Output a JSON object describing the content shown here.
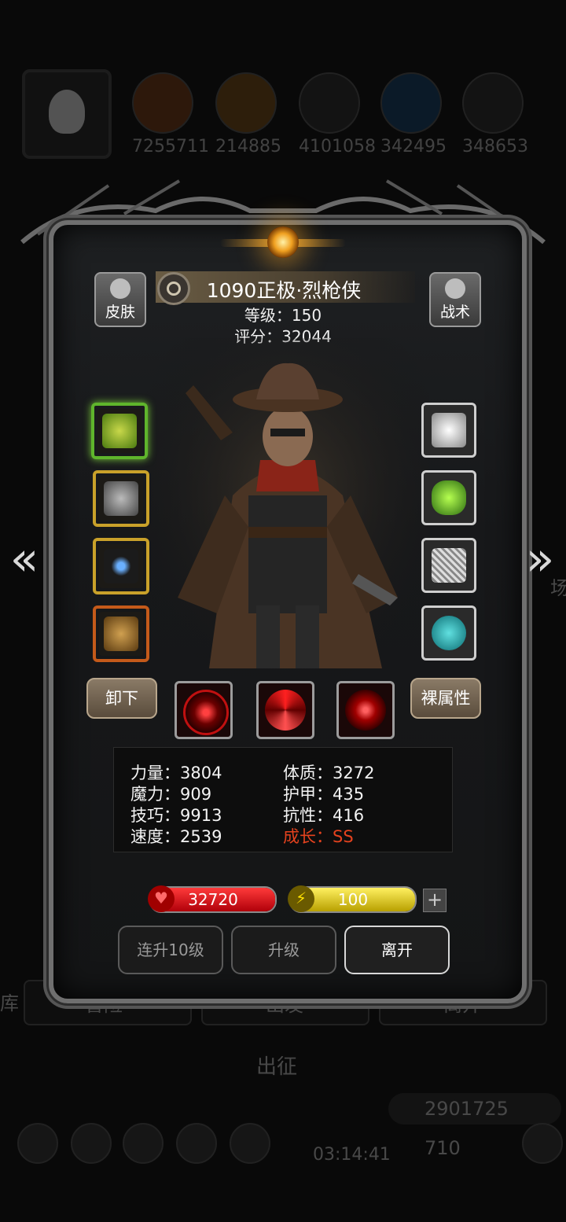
{
  "background": {
    "resources": [
      "7255711",
      "214885",
      "4101058",
      "342495",
      "348653"
    ],
    "bottom_buttons": [
      "冒险",
      "出发",
      "离开"
    ],
    "march_label": "出征",
    "gold": "2901725",
    "gems": "710",
    "timer": "03:14:41",
    "left_edge_text": "库",
    "right_edge_text": "场"
  },
  "hero": {
    "name": "1090正极·烈枪侠",
    "level": "等级：150",
    "score": "评分：32044"
  },
  "corner_buttons": {
    "skin": "皮肤",
    "tactics": "战术"
  },
  "equipment": {
    "left": [
      "golden-gun",
      "silver-armor",
      "blue-amulet",
      "bronze-horn"
    ],
    "right": [
      "cloud-ring",
      "green-gem",
      "chainmail",
      "cyan-stone"
    ]
  },
  "actions": {
    "unequip": "卸下",
    "bare_stats": "裸属性"
  },
  "skills": [
    "crosshair-skill",
    "vortex-skill",
    "target-skill"
  ],
  "stats": {
    "strength": "力量：3804",
    "magic": "魔力：909",
    "skill": "技巧：9913",
    "speed": "速度：2539",
    "constitution": "体质：3272",
    "armor": "护甲：435",
    "resistance": "抗性：416",
    "growth": "成长：SS"
  },
  "hp": {
    "value": "32720",
    "fill": 1.0
  },
  "energy": {
    "value": "100",
    "fill": 1.0
  },
  "buttons": {
    "level_up_10": "连升10级",
    "level_up": "升级",
    "leave": "离开"
  },
  "colors": {
    "accent_red": "#e4421e",
    "hp": "#d0141a",
    "energy": "#e6d21c"
  }
}
